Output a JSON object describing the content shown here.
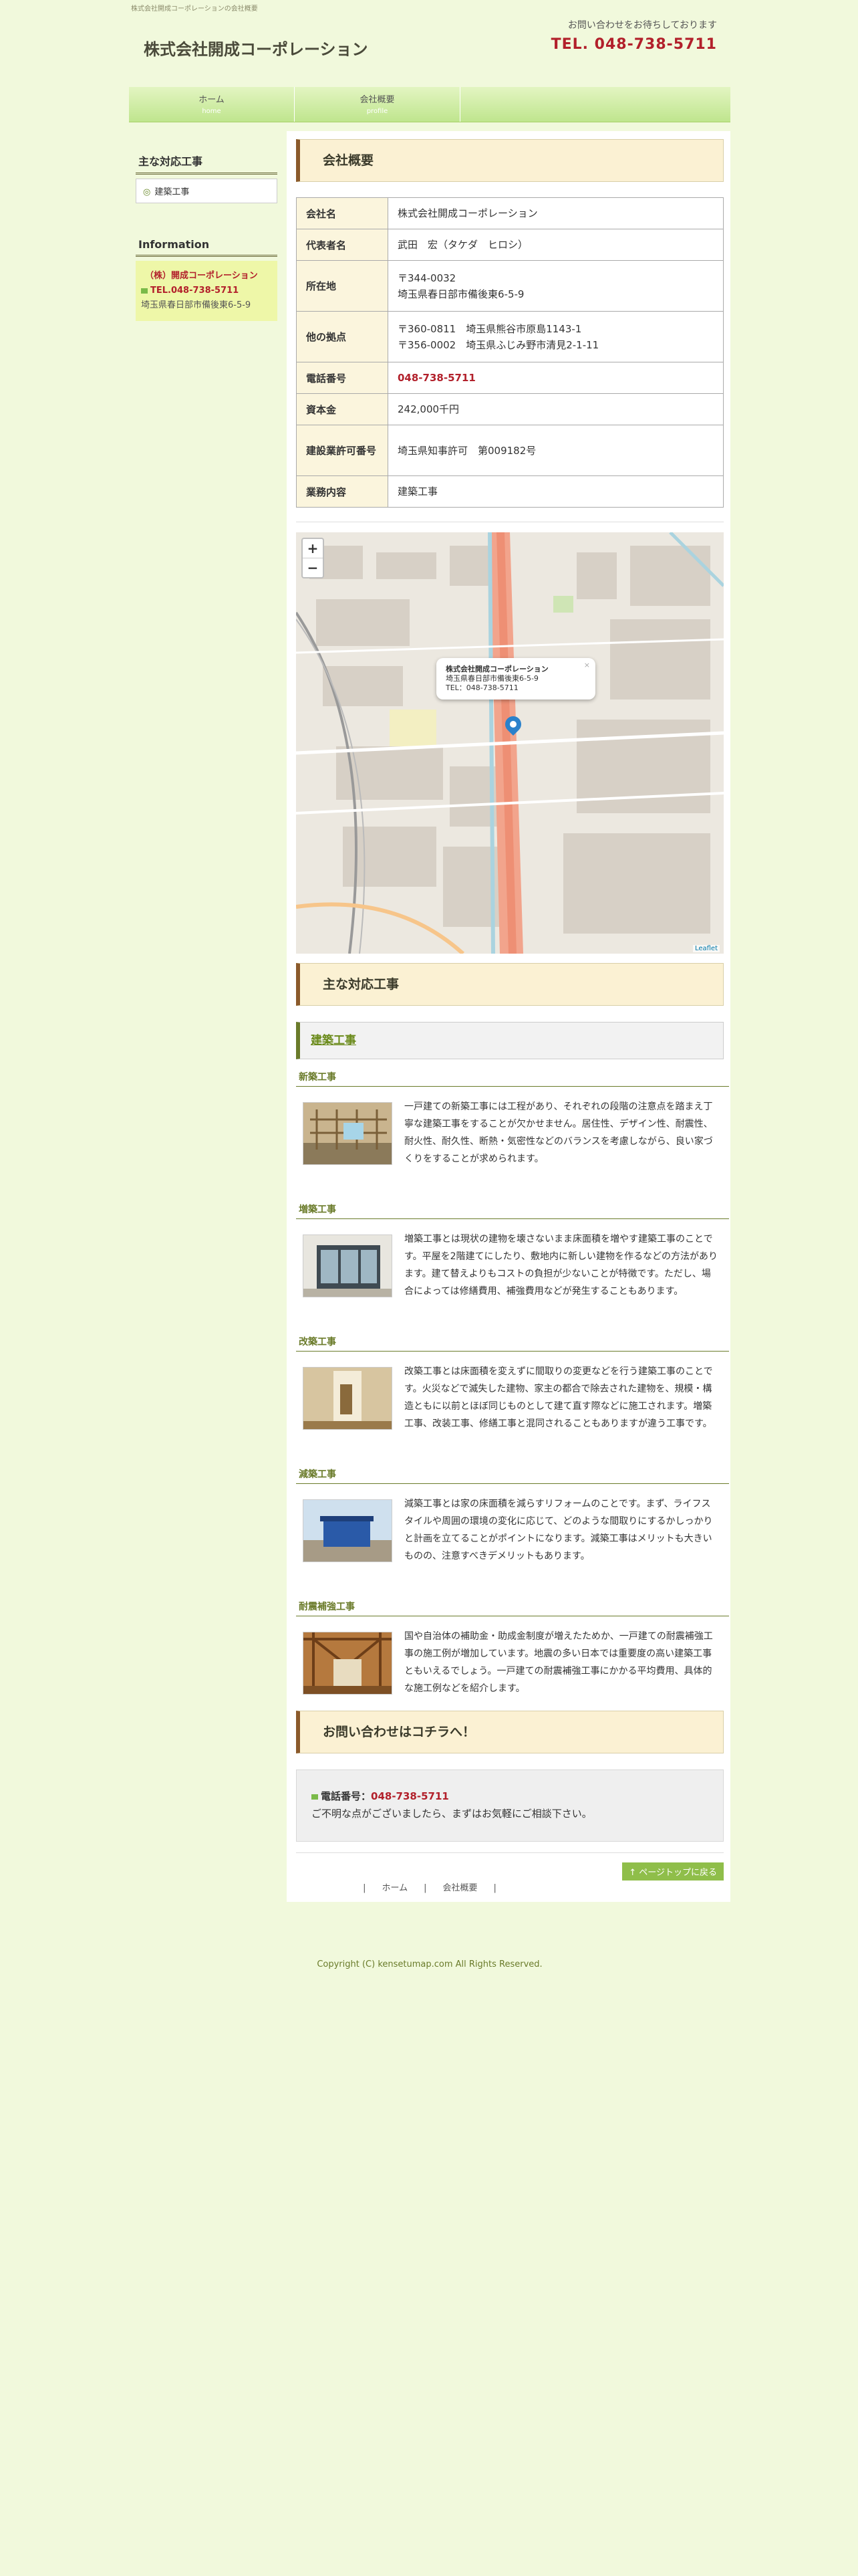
{
  "header": {
    "description": "株式会社開成コーポレーションの会社概要",
    "site_title": "株式会社開成コーポレーション",
    "contact_message": "お問い合わせをお待ちしております",
    "contact_tel": "TEL. 048-738-5711"
  },
  "nav": [
    {
      "label": "ホーム",
      "sub": "home"
    },
    {
      "label": "会社概要",
      "sub": "profile"
    }
  ],
  "sidebar": {
    "services_heading": "主な対応工事",
    "services": [
      "建築工事"
    ],
    "info_heading": "Information",
    "info_name": "（株）開成コーポレーション",
    "info_tel": "TEL.048-738-5711",
    "info_address": "埼玉県春日部市備後東6-5-9"
  },
  "profile": {
    "heading": "会社概要",
    "rows": [
      {
        "label": "会社名",
        "value": "株式会社開成コーポレーション"
      },
      {
        "label": "代表者名",
        "value": "武田　宏（タケダ　ヒロシ）"
      },
      {
        "label": "所在地",
        "value": "〒344-0032",
        "value2": "埼玉県春日部市備後東6-5-9"
      },
      {
        "label": "他の拠点",
        "value": "〒360-0811　埼玉県熊谷市原島1143-1",
        "value2": "〒356-0002　埼玉県ふじみ野市清見2-1-11"
      },
      {
        "label": "電話番号",
        "value": "048-738-5711"
      },
      {
        "label": "資本金",
        "value": "242,000千円"
      },
      {
        "label": "建設業許可番号",
        "value": "埼玉県知事許可　第009182号"
      },
      {
        "label": "業務内容",
        "value": "建築工事"
      }
    ]
  },
  "map": {
    "zoom_in": "+",
    "zoom_out": "−",
    "popup_name": "株式会社開成コーポレーション",
    "popup_address": "埼玉県春日部市備後東6-5-9",
    "popup_tel": "TEL：048-738-5711",
    "popup_close": "×",
    "attribution": "Leaflet"
  },
  "services": {
    "heading": "主な対応工事",
    "category": "建築工事",
    "items": [
      {
        "title": "新築工事",
        "text": "一戸建ての新築工事には工程があり、それぞれの段階の注意点を踏まえ丁寧な建築工事をすることが欠かせません。居住性、デザイン性、耐震性、耐火性、耐久性、断熱・気密性などのバランスを考慮しながら、良い家づくりをすることが求められます。"
      },
      {
        "title": "増築工事",
        "text": "増築工事とは現状の建物を壊さないまま床面積を増やす建築工事のことです。平屋を2階建てにしたり、敷地内に新しい建物を作るなどの方法があります。建て替えよりもコストの負担が少ないことが特徴です。ただし、場合によっては修繕費用、補強費用などが発生することもあります。"
      },
      {
        "title": "改築工事",
        "text": "改築工事とは床面積を変えずに間取りの変更などを行う建築工事のことです。火災などで滅失した建物、家主の都合で除去された建物を、規模・構造ともに以前とほぼ同じものとして建て直す際などに施工されます。増築工事、改装工事、修繕工事と混同されることもありますが違う工事です。"
      },
      {
        "title": "減築工事",
        "text": "減築工事とは家の床面積を減らすリフォームのことです。まず、ライフスタイルや周囲の環境の変化に応じて、どのような間取りにするかしっかりと計画を立てることがポイントになります。減築工事はメリットも大きいものの、注意すべきデメリットもあります。"
      },
      {
        "title": "耐震補強工事",
        "text": "国や自治体の補助金・助成金制度が増えたためか、一戸建ての耐震補強工事の施工例が増加しています。地震の多い日本では重要度の高い建築工事ともいえるでしょう。一戸建ての耐震補強工事にかかる平均費用、具体的な施工例などを紹介します。"
      }
    ]
  },
  "contact": {
    "heading": "お問い合わせはコチラへ！",
    "label": "電話番号：",
    "tel": "048-738-5711",
    "note": "ご不明な点がございましたら、まずはお気軽にご相談下さい。",
    "to_top": "↑ ページトップに戻る"
  },
  "footer": {
    "links": [
      "ホーム",
      "会社概要"
    ],
    "copyright": "Copyright (C) kensetumap.com All Rights Reserved."
  },
  "colors": {
    "accent": "#b2202b",
    "background": "#f1f9dc",
    "nav": "#bfe58e"
  }
}
